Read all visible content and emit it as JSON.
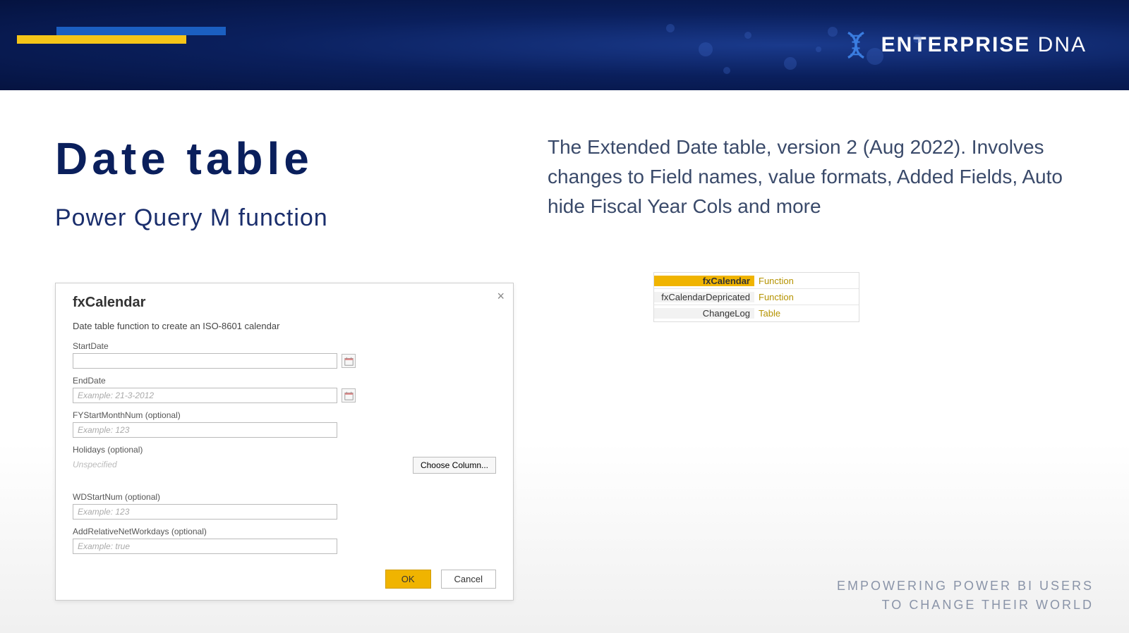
{
  "brand": {
    "name1": "ENTERPRISE",
    "name2": "DNA"
  },
  "title": "Date table",
  "subtitle": "Power Query M function",
  "description": "The Extended Date table, version 2 (Aug 2022). Involves changes to Field names, value formats, Added Fields, Auto hide Fiscal Year Cols and more",
  "dialog": {
    "title": "fxCalendar",
    "desc": "Date table function to create an ISO-8601 calendar",
    "fields": {
      "start": {
        "label": "StartDate",
        "placeholder": ""
      },
      "end": {
        "label": "EndDate",
        "placeholder": "Example: 21-3-2012"
      },
      "fy": {
        "label": "FYStartMonthNum (optional)",
        "placeholder": "Example: 123"
      },
      "holidays": {
        "label": "Holidays (optional)",
        "unspecified": "Unspecified",
        "choose": "Choose Column..."
      },
      "wd": {
        "label": "WDStartNum (optional)",
        "placeholder": "Example: 123"
      },
      "rel": {
        "label": "AddRelativeNetWorkdays (optional)",
        "placeholder": "Example: true"
      }
    },
    "ok": "OK",
    "cancel": "Cancel"
  },
  "queries": [
    {
      "name": "fxCalendar",
      "type": "Function",
      "selected": true
    },
    {
      "name": "fxCalendarDepricated",
      "type": "Function",
      "selected": false
    },
    {
      "name": "ChangeLog",
      "type": "Table",
      "selected": false
    }
  ],
  "footer": {
    "l1": "EMPOWERING POWER BI USERS",
    "l2": "TO CHANGE THEIR WORLD"
  }
}
